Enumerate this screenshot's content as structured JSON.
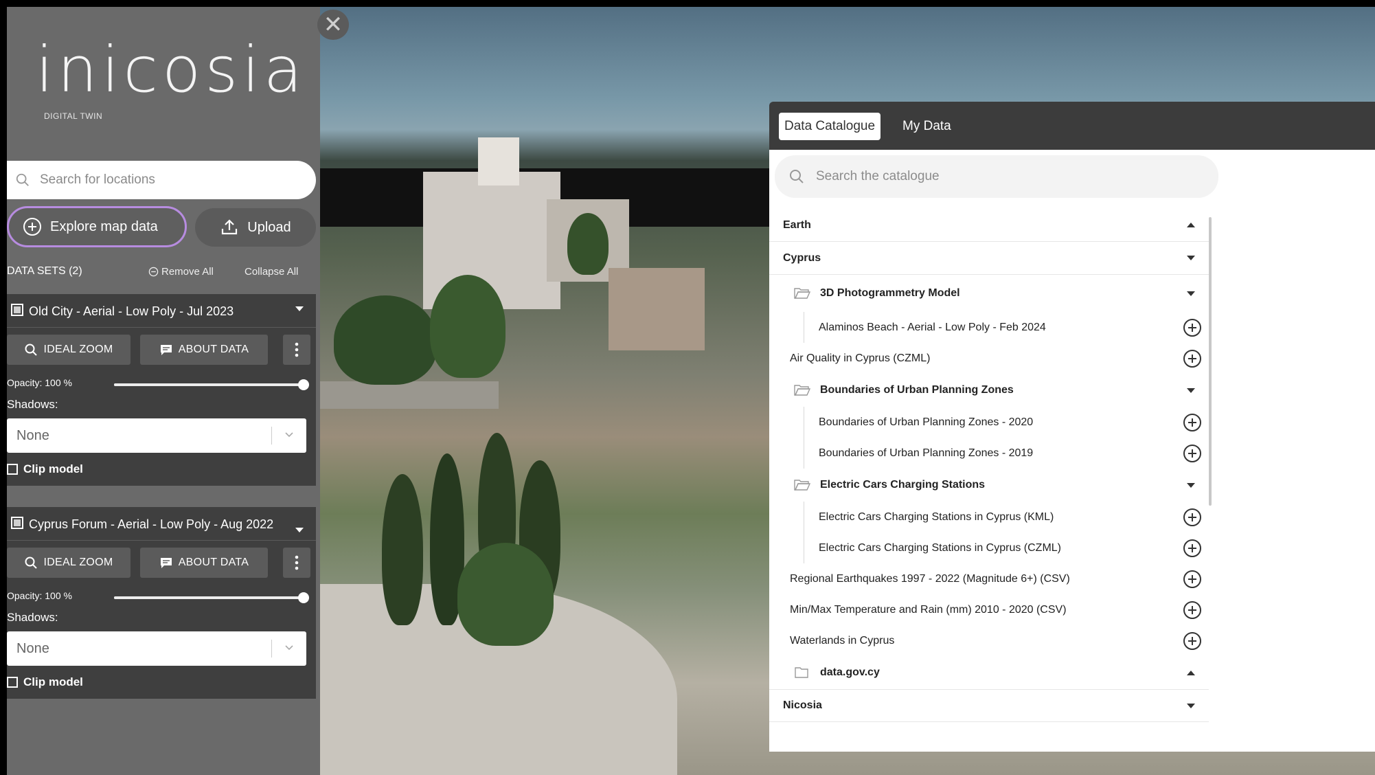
{
  "app": {
    "logo_text": "inicosia",
    "logo_subtitle": "DIGITAL TWIN",
    "close_glyph": "✕"
  },
  "sidebar": {
    "search_placeholder": "Search for locations",
    "explore_label": "Explore map data",
    "upload_label": "Upload",
    "datasets_title": "DATA SETS (2)",
    "remove_all_label": "Remove All",
    "collapse_all_label": "Collapse All",
    "datasets": [
      {
        "title": "Old City - Aerial - Low Poly - Jul 2023",
        "ideal_zoom_label": "IDEAL ZOOM",
        "about_data_label": "ABOUT DATA",
        "opacity_label": "Opacity: 100 %",
        "opacity_value": 1.0,
        "shadows_label": "Shadows:",
        "shadows_value": "None",
        "clip_label": "Clip model"
      },
      {
        "title": "Cyprus Forum - Aerial - Low Poly - Aug 2022",
        "ideal_zoom_label": "IDEAL ZOOM",
        "about_data_label": "ABOUT DATA",
        "opacity_label": "Opacity: 100 %",
        "opacity_value": 1.0,
        "shadows_label": "Shadows:",
        "shadows_value": "None",
        "clip_label": "Clip model"
      }
    ]
  },
  "catalogue": {
    "tabs": [
      "Data Catalogue",
      "My Data"
    ],
    "active_tab": "Data Catalogue",
    "search_placeholder": "Search the catalogue",
    "items": {
      "earth": "Earth",
      "cyprus": "Cyprus",
      "photogrammetry": "3D Photogrammetry Model",
      "alaminos": "Alaminos Beach - Aerial - Low Poly - Feb 2024",
      "air_quality": "Air Quality in Cyprus (CZML)",
      "boundaries": "Boundaries of Urban Planning Zones",
      "boundaries_2020": "Boundaries of Urban Planning Zones - 2020",
      "boundaries_2019": "Boundaries of Urban Planning Zones - 2019",
      "ev_group": "Electric Cars Charging Stations",
      "ev_kml": "Electric Cars Charging Stations in Cyprus (KML)",
      "ev_czml": "Electric Cars Charging Stations in Cyprus (CZML)",
      "earthquakes": "Regional Earthquakes 1997 - 2022 (Magnitude 6+) (CSV)",
      "temperature": "Min/Max Temperature and Rain (mm) 2010 - 2020 (CSV)",
      "waterlands": "Waterlands in Cyprus",
      "datagov": "data.gov.cy",
      "nicosia": "Nicosia"
    }
  },
  "colors": {
    "sidebar_bg": "#6a6a6a",
    "card_bg": "#3f3f3f",
    "accent_border": "#b78ce0",
    "tab_bar": "#3c3c3c"
  }
}
